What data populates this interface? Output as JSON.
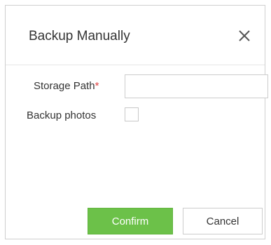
{
  "dialog": {
    "title": "Backup Manually",
    "close_icon": "close-icon"
  },
  "form": {
    "storage_path_label": "Storage Path",
    "required_mark": "*",
    "storage_path_value": "",
    "backup_photos_label": "Backup photos",
    "backup_photos_checked": false
  },
  "buttons": {
    "confirm_label": "Confirm",
    "cancel_label": "Cancel"
  },
  "colors": {
    "confirm_bg": "#6cc149",
    "required": "#e04040"
  }
}
